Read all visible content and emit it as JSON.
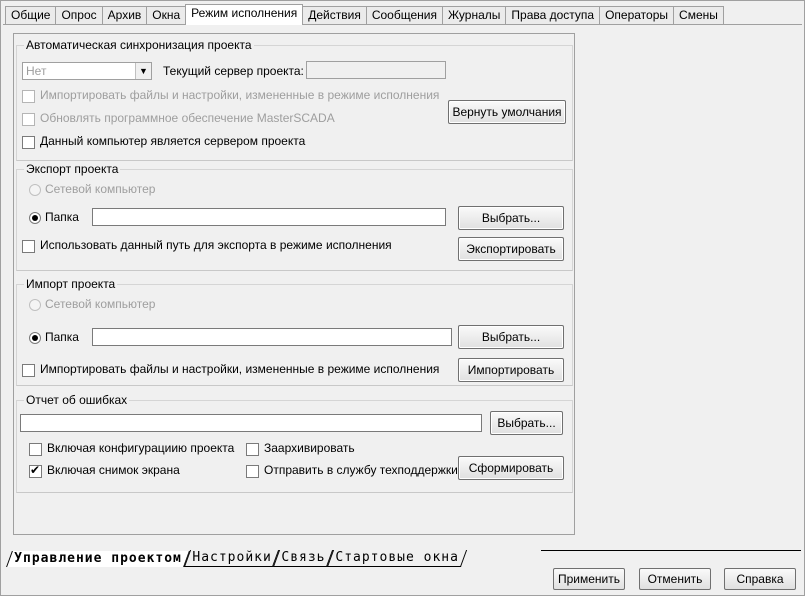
{
  "tabs": [
    "Общие",
    "Опрос",
    "Архив",
    "Окна",
    "Режим исполнения",
    "Действия",
    "Сообщения",
    "Журналы",
    "Права доступа",
    "Операторы",
    "Смены"
  ],
  "active_tab": "Режим исполнения",
  "sync": {
    "title": "Автоматическая синхронизация проекта",
    "mode_value": "Нет",
    "server_label": "Текущий сервер проекта:",
    "server_value": "",
    "import_changed": "Импортировать файлы и настройки, измененные в режиме исполнения",
    "update_software": "Обновлять программное обеспечение MasterSCADA",
    "is_server": "Данный компьютер является сервером проекта",
    "restore_defaults": "Вернуть умолчания"
  },
  "export": {
    "title": "Экспорт проекта",
    "network_computer": "Сетевой компьютер",
    "folder": "Папка",
    "folder_value": "",
    "browse": "Выбрать...",
    "use_path": "Использовать данный путь для экспорта в режиме исполнения",
    "action": "Экспортировать"
  },
  "import": {
    "title": "Импорт проекта",
    "network_computer": "Сетевой компьютер",
    "folder": "Папка",
    "folder_value": "",
    "browse": "Выбрать...",
    "import_changed": "Импортировать файлы и настройки, измененные в режиме исполнения",
    "action": "Импортировать"
  },
  "errors": {
    "title": "Отчет об ошибках",
    "path_value": "",
    "browse": "Выбрать...",
    "include_config": "Включая конфигурациию проекта",
    "archive": "Заархивировать",
    "include_screenshot": "Включая снимок экрана",
    "send_support": "Отправить в службу техподдержки",
    "generate": "Сформировать"
  },
  "bottom_tabs": [
    "Управление проектом",
    "Настройки",
    "Связь",
    "Стартовые окна"
  ],
  "footer": {
    "apply": "Применить",
    "cancel": "Отменить",
    "help": "Справка"
  }
}
